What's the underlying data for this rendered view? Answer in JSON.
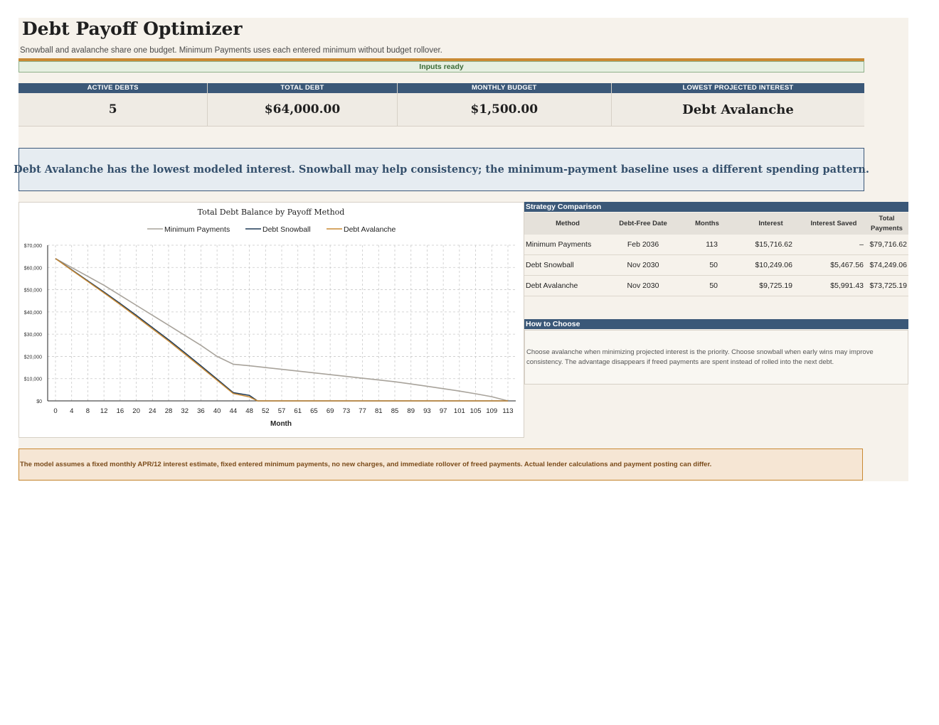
{
  "header": {
    "title": "Debt Payoff Optimizer",
    "subtitle": "Snowball and avalanche share one budget. Minimum Payments uses each entered minimum without budget rollover.",
    "status": "Inputs ready"
  },
  "kpis": [
    {
      "label": "ACTIVE DEBTS",
      "value": "5"
    },
    {
      "label": "TOTAL DEBT",
      "value": "$64,000.00"
    },
    {
      "label": "MONTHLY BUDGET",
      "value": "$1,500.00"
    },
    {
      "label": "LOWEST PROJECTED INTEREST",
      "value": "Debt Avalanche"
    }
  ],
  "banner": "Debt Avalanche has the lowest modeled interest. Snowball may help consistency; the minimum-payment baseline uses a different spending pattern.",
  "chart_data": {
    "type": "line",
    "title": "Total Debt Balance by Payoff Method",
    "xlabel": "Month",
    "ylabel": "",
    "ylim": [
      0,
      70000
    ],
    "yticks": [
      0,
      10000,
      20000,
      30000,
      40000,
      50000,
      60000,
      70000
    ],
    "ytick_labels": [
      "$0",
      "$10,000",
      "$20,000",
      "$30,000",
      "$40,000",
      "$50,000",
      "$60,000",
      "$70,000"
    ],
    "xticks": [
      "0",
      "4",
      "8",
      "12",
      "16",
      "20",
      "24",
      "28",
      "32",
      "36",
      "40",
      "44",
      "48",
      "52",
      "57",
      "61",
      "65",
      "69",
      "73",
      "77",
      "81",
      "85",
      "89",
      "93",
      "97",
      "101",
      "105",
      "109",
      "113"
    ],
    "grid": true,
    "legend_position": "top",
    "series": [
      {
        "name": "Minimum Payments",
        "color": "#a8a39b",
        "points": [
          [
            0,
            64000
          ],
          [
            4,
            60000
          ],
          [
            8,
            56000
          ],
          [
            12,
            52000
          ],
          [
            16,
            47500
          ],
          [
            20,
            43000
          ],
          [
            24,
            38500
          ],
          [
            28,
            34000
          ],
          [
            32,
            29500
          ],
          [
            36,
            25000
          ],
          [
            40,
            20000
          ],
          [
            44,
            16500
          ],
          [
            48,
            15800
          ],
          [
            52,
            15000
          ],
          [
            57,
            14200
          ],
          [
            61,
            13400
          ],
          [
            65,
            12600
          ],
          [
            69,
            11800
          ],
          [
            73,
            11000
          ],
          [
            77,
            10200
          ],
          [
            81,
            9400
          ],
          [
            85,
            8600
          ],
          [
            89,
            7600
          ],
          [
            93,
            6600
          ],
          [
            97,
            5500
          ],
          [
            101,
            4400
          ],
          [
            105,
            3200
          ],
          [
            109,
            1900
          ],
          [
            113,
            0
          ]
        ]
      },
      {
        "name": "Debt Snowball",
        "color": "#1f3a57",
        "points": [
          [
            0,
            64000
          ],
          [
            4,
            59000
          ],
          [
            8,
            54000
          ],
          [
            12,
            49000
          ],
          [
            16,
            43800
          ],
          [
            20,
            38500
          ],
          [
            24,
            33000
          ],
          [
            28,
            27500
          ],
          [
            32,
            21700
          ],
          [
            36,
            15800
          ],
          [
            40,
            9800
          ],
          [
            44,
            3700
          ],
          [
            48,
            2500
          ],
          [
            50,
            0
          ],
          [
            113,
            0
          ]
        ]
      },
      {
        "name": "Debt Avalanche",
        "color": "#c98a34",
        "points": [
          [
            0,
            64000
          ],
          [
            4,
            58800
          ],
          [
            8,
            53700
          ],
          [
            12,
            48600
          ],
          [
            16,
            43300
          ],
          [
            20,
            37900
          ],
          [
            24,
            32400
          ],
          [
            28,
            26900
          ],
          [
            32,
            21100
          ],
          [
            36,
            15200
          ],
          [
            40,
            9300
          ],
          [
            44,
            3300
          ],
          [
            48,
            1800
          ],
          [
            50,
            0
          ],
          [
            113,
            0
          ]
        ]
      }
    ]
  },
  "comparison": {
    "title": "Strategy Comparison",
    "columns": [
      "Method",
      "Debt-Free Date",
      "Months",
      "Interest",
      "Interest Saved",
      "Total Payments"
    ],
    "rows": [
      [
        "Minimum Payments",
        "Feb 2036",
        "113",
        "$15,716.62",
        "–",
        "$79,716.62"
      ],
      [
        "Debt Snowball",
        "Nov 2030",
        "50",
        "$10,249.06",
        "$5,467.56",
        "$74,249.06"
      ],
      [
        "Debt Avalanche",
        "Nov 2030",
        "50",
        "$9,725.19",
        "$5,991.43",
        "$73,725.19"
      ]
    ]
  },
  "how_to_choose": {
    "title": "How to Choose",
    "text": "Choose avalanche when minimizing projected interest is the priority. Choose snowball when early wins may improve consistency. The advantage disappears if freed payments are spent instead of rolled into the next debt."
  },
  "footnote": "The model assumes a fixed monthly APR/12 interest estimate, fixed entered minimum payments, no new charges, and immediate rollover of freed payments. Actual lender calculations and payment posting can differ."
}
